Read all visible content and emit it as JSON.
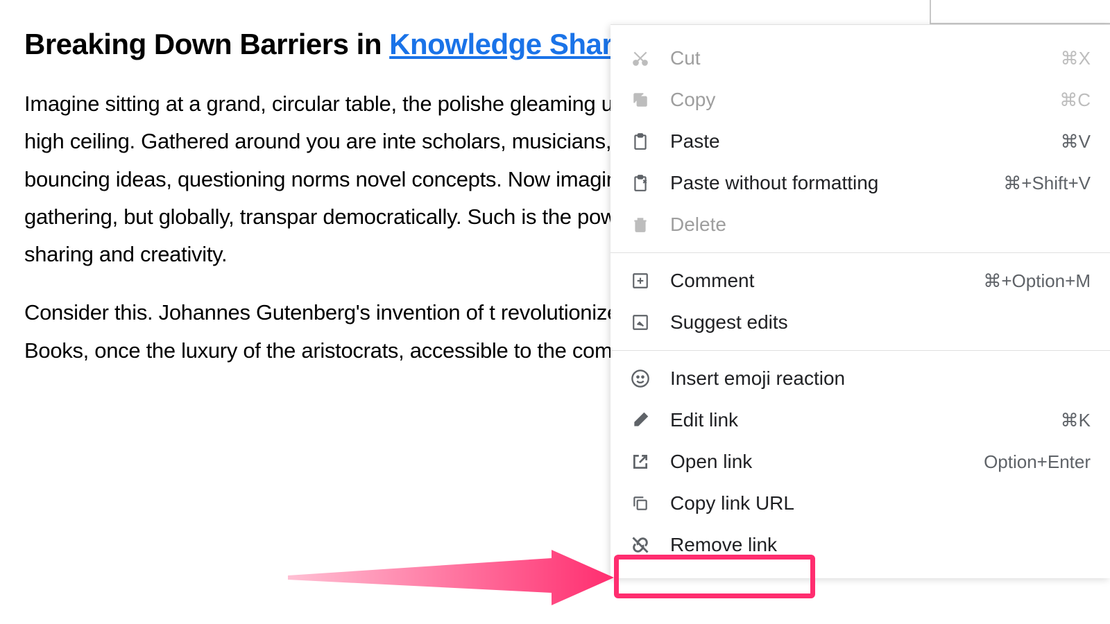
{
  "document": {
    "title_prefix": "Breaking Down Barriers in ",
    "title_link": "Knowledge Shar",
    "paragraph1": "Imagine sitting at a grand, circular table, the polishe gleaming under the soft glow of the opulent chande from the high ceiling. Gathered around you are inte scholars, musicians, scientists, and artists, each co lively discourse, bouncing ideas, questioning norms novel concepts. Now imagine this happening, not ju confines of an elite gathering, but globally, transpar democratically. Such is the power of generative AI democratizes knowledge sharing and creativity.",
    "paragraph2": "Consider this. Johannes Gutenberg's invention of t revolutionized the way knowledge was shared acro societies. Books, once the luxury of the aristocrats, accessible to the common man, triggering an explo"
  },
  "menu": {
    "cut": {
      "label": "Cut",
      "shortcut": "⌘X"
    },
    "copy": {
      "label": "Copy",
      "shortcut": "⌘C"
    },
    "paste": {
      "label": "Paste",
      "shortcut": "⌘V"
    },
    "paste_without_formatting": {
      "label": "Paste without formatting",
      "shortcut": "⌘+Shift+V"
    },
    "delete": {
      "label": "Delete",
      "shortcut": ""
    },
    "comment": {
      "label": "Comment",
      "shortcut": "⌘+Option+M"
    },
    "suggest_edits": {
      "label": "Suggest edits",
      "shortcut": ""
    },
    "insert_emoji": {
      "label": "Insert emoji reaction",
      "shortcut": ""
    },
    "edit_link": {
      "label": "Edit link",
      "shortcut": "⌘K"
    },
    "open_link": {
      "label": "Open link",
      "shortcut": "Option+Enter"
    },
    "copy_link_url": {
      "label": "Copy link URL",
      "shortcut": ""
    },
    "remove_link": {
      "label": "Remove link",
      "shortcut": ""
    }
  }
}
